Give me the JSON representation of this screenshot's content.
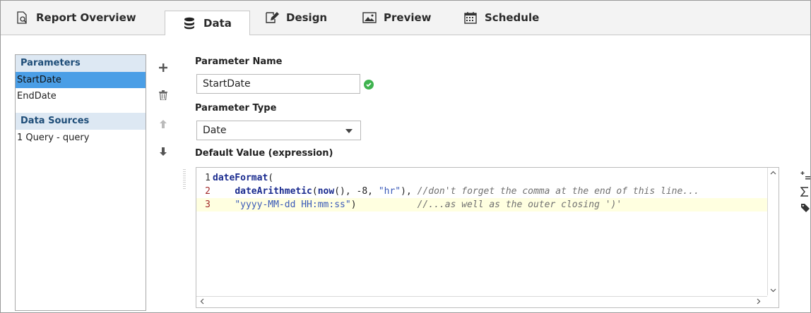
{
  "tabs": [
    {
      "label": "Report Overview",
      "icon": "report-overview-icon"
    },
    {
      "label": "Data",
      "icon": "database-icon",
      "active": true
    },
    {
      "label": "Design",
      "icon": "design-icon"
    },
    {
      "label": "Preview",
      "icon": "preview-icon"
    },
    {
      "label": "Schedule",
      "icon": "calendar-icon"
    }
  ],
  "left_panel": {
    "parameters_header": "Parameters",
    "parameters": [
      "StartDate",
      "EndDate"
    ],
    "selected_parameter": "StartDate",
    "data_sources_header": "Data Sources",
    "data_sources": [
      "1 Query - query"
    ]
  },
  "toolbar": {
    "add": "add-icon",
    "delete": "trash-icon",
    "move_up": "arrow-up-icon",
    "move_down": "arrow-down-icon"
  },
  "form": {
    "name_label": "Parameter Name",
    "name_value": "StartDate",
    "type_label": "Parameter Type",
    "type_value": "Date",
    "default_label": "Default Value (expression)"
  },
  "editor": {
    "lines": [
      {
        "num": "1",
        "parts": [
          [
            "fn",
            "dateFormat"
          ],
          [
            "plain",
            "("
          ]
        ]
      },
      {
        "num": "2",
        "parts": [
          [
            "plain",
            "    "
          ],
          [
            "fn",
            "dateArithmetic"
          ],
          [
            "plain",
            "("
          ],
          [
            "fn",
            "now"
          ],
          [
            "plain",
            "(), -8, "
          ],
          [
            "str",
            "\"hr\""
          ],
          [
            "plain",
            "), "
          ],
          [
            "cm",
            "//don't forget the comma at the end of this line..."
          ]
        ]
      },
      {
        "num": "3",
        "parts": [
          [
            "plain",
            "    "
          ],
          [
            "str",
            "\"yyyy-MM-dd HH:mm:ss\""
          ],
          [
            "plain",
            ")           "
          ],
          [
            "cm",
            "//...as well as the outer closing ')'"
          ]
        ]
      }
    ]
  },
  "right_toolbar": [
    "insert-property-icon",
    "sigma-function-icon",
    "tag-icon"
  ],
  "colors": {
    "selection": "#4a9ee6",
    "section_header_bg": "#dde8f3",
    "valid_check": "#3fb34f",
    "highlight_line": "#ffffe0"
  }
}
